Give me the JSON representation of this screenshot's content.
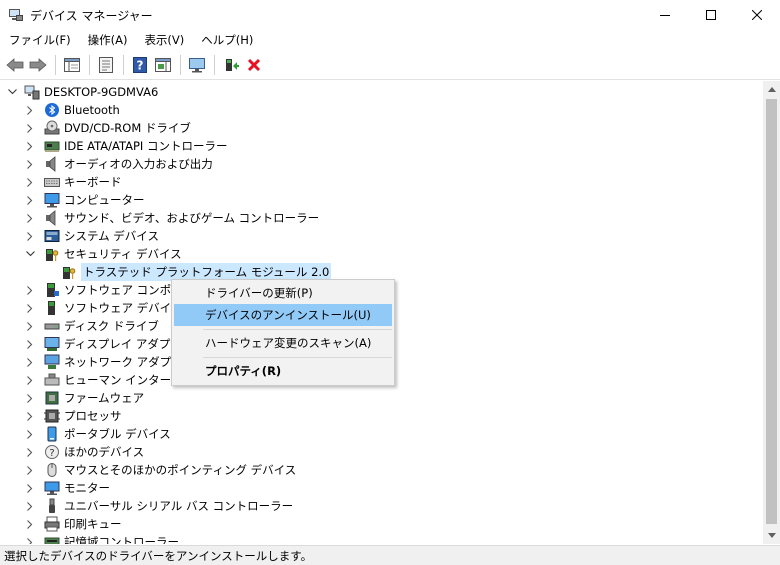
{
  "window": {
    "title": "デバイス マネージャー"
  },
  "menu": [
    "ファイル(F)",
    "操作(A)",
    "表示(V)",
    "ヘルプ(H)"
  ],
  "toolbar": {
    "buttons": [
      "back-arrow-icon",
      "forward-arrow-icon",
      "show-hide-console-tree-icon",
      "properties-icon",
      "help-icon",
      "action-pane-icon",
      "monitor-icon",
      "update-driver-icon",
      "uninstall-device-icon"
    ]
  },
  "tree": {
    "root": "DESKTOP-9GDMVA6",
    "items": [
      {
        "label": "Bluetooth",
        "icon": "bluetooth-icon"
      },
      {
        "label": "DVD/CD-ROM ドライブ",
        "icon": "disc-drive-icon"
      },
      {
        "label": "IDE ATA/ATAPI コントローラー",
        "icon": "ide-controller-icon"
      },
      {
        "label": "オーディオの入力および出力",
        "icon": "speaker-icon"
      },
      {
        "label": "キーボード",
        "icon": "keyboard-icon"
      },
      {
        "label": "コンピューター",
        "icon": "computer-icon"
      },
      {
        "label": "サウンド、ビデオ、およびゲーム コントローラー",
        "icon": "speaker-icon"
      },
      {
        "label": "システム デバイス",
        "icon": "system-device-icon"
      },
      {
        "label": "セキュリティ デバイス",
        "icon": "security-device-icon",
        "expanded": true
      },
      {
        "label": "トラステッド プラットフォーム モジュール 2.0",
        "icon": "security-device-icon",
        "child": true,
        "selected": true
      },
      {
        "label": "ソフトウェア コンポーネント",
        "icon": "software-component-icon"
      },
      {
        "label": "ソフトウェア デバイス",
        "icon": "software-device-icon"
      },
      {
        "label": "ディスク ドライブ",
        "icon": "disk-drive-icon"
      },
      {
        "label": "ディスプレイ アダプター",
        "icon": "display-adapter-icon"
      },
      {
        "label": "ネットワーク アダプター",
        "icon": "network-adapter-icon"
      },
      {
        "label": "ヒューマン インターフェイス デバイス",
        "icon": "hid-icon"
      },
      {
        "label": "ファームウェア",
        "icon": "firmware-icon"
      },
      {
        "label": "プロセッサ",
        "icon": "processor-icon"
      },
      {
        "label": "ポータブル デバイス",
        "icon": "portable-device-icon"
      },
      {
        "label": "ほかのデバイス",
        "icon": "other-device-icon"
      },
      {
        "label": "マウスとそのほかのポインティング デバイス",
        "icon": "mouse-icon"
      },
      {
        "label": "モニター",
        "icon": "monitor-icon"
      },
      {
        "label": "ユニバーサル シリアル バス コントローラー",
        "icon": "usb-icon"
      },
      {
        "label": "印刷キュー",
        "icon": "printer-icon"
      },
      {
        "label": "記憶域コントローラー",
        "icon": "storage-controller-icon"
      }
    ]
  },
  "context_menu": {
    "items": [
      "ドライバーの更新(P)",
      "デバイスのアンインストール(U)",
      "ハードウェア変更のスキャン(A)",
      "プロパティ(R)"
    ],
    "highlighted_index": 1
  },
  "status": {
    "text": "選択したデバイスのドライバーをアンインストールします。"
  },
  "colors": {
    "selection": "#cce8ff",
    "menu_highlight": "#91c9f7",
    "uninstall_red": "#e81123"
  }
}
